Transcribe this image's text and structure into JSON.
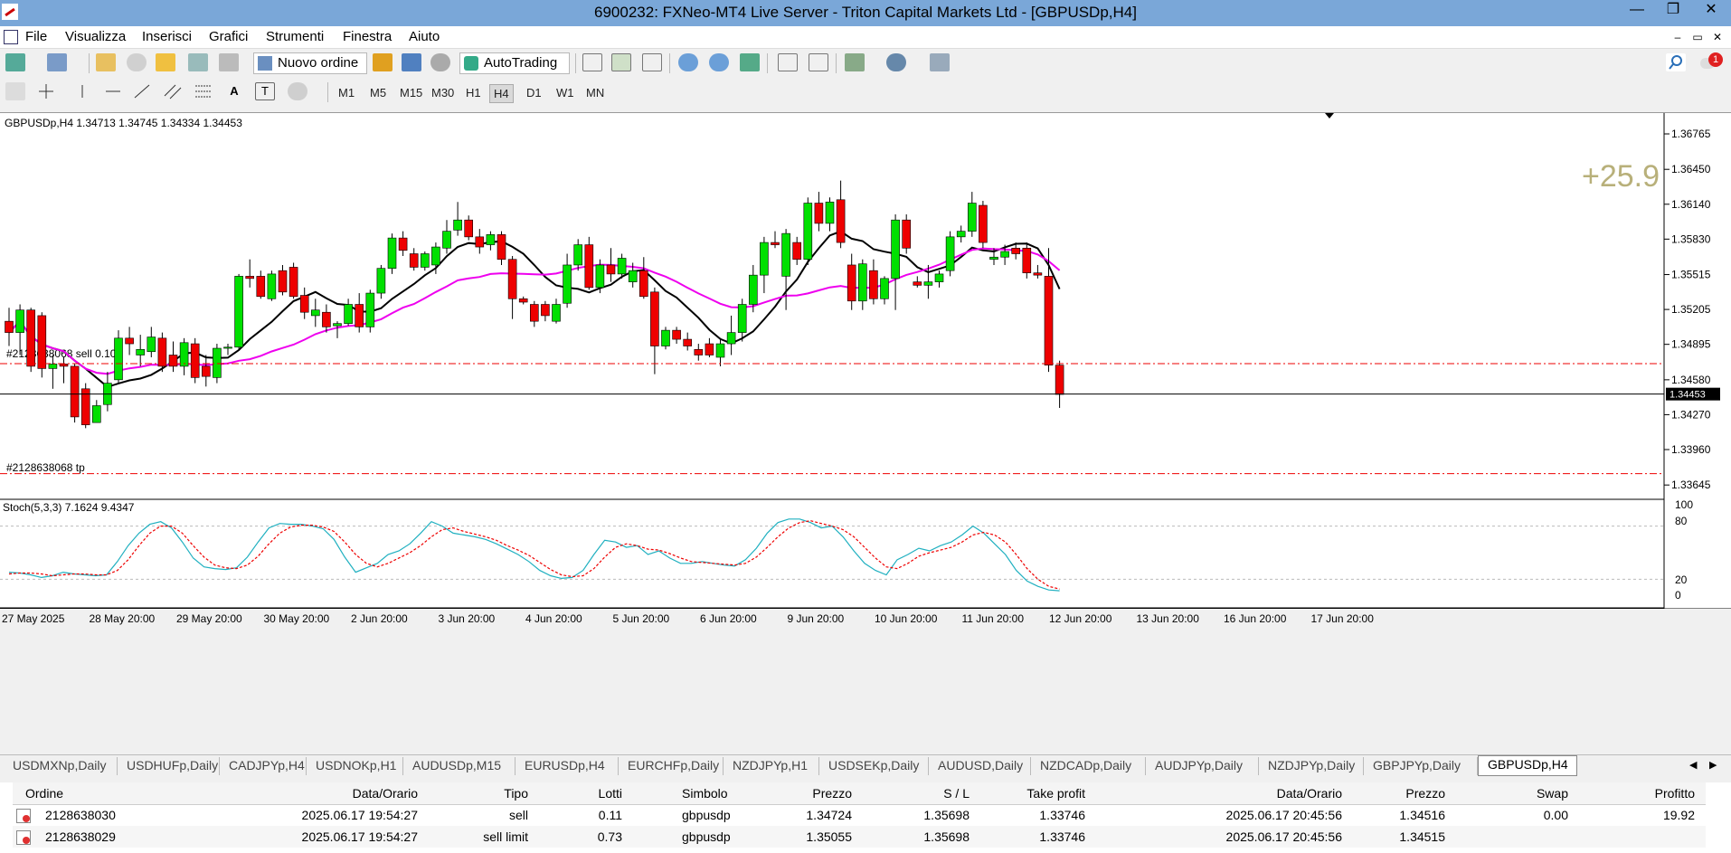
{
  "window": {
    "title": "6900232: FXNeo-MT4 Live Server - Triton Capital Markets Ltd - [GBPUSDp,H4]",
    "minimize": "—",
    "restore": "❐",
    "close": "✕"
  },
  "menu": [
    "File",
    "Visualizza",
    "Inserisci",
    "Grafici",
    "Strumenti",
    "Finestra",
    "Aiuto"
  ],
  "mdi": {
    "minimize": "–",
    "restore": "▭",
    "close": "✕"
  },
  "notification_count": "1",
  "toolbar": {
    "new_order": "Nuovo ordine",
    "autotrading": "AutoTrading"
  },
  "timeframes": [
    "M1",
    "M5",
    "M15",
    "M30",
    "H1",
    "H4",
    "D1",
    "W1",
    "MN"
  ],
  "active_timeframe": "H4",
  "chart": {
    "header": "GBPUSDp,H4  1.34713 1.34745 1.34334 1.34453",
    "profit_display": "+25.9",
    "order_label": "#2128638068 sell 0.10",
    "tp_label": "#2128638068 tp",
    "current_price": "1.34453",
    "price_labels": [
      "1.36765",
      "1.36450",
      "1.36140",
      "1.35830",
      "1.35515",
      "1.35205",
      "1.34895",
      "1.34580",
      "1.34270",
      "1.33960",
      "1.33645"
    ],
    "time_labels": [
      "27 May 2025",
      "28 May 20:00",
      "29 May 20:00",
      "30 May 20:00",
      "2 Jun 20:00",
      "3 Jun 20:00",
      "4 Jun 20:00",
      "5 Jun 20:00",
      "6 Jun 20:00",
      "9 Jun 20:00",
      "10 Jun 20:00",
      "11 Jun 20:00",
      "12 Jun 20:00",
      "13 Jun 20:00",
      "16 Jun 20:00",
      "17 Jun 20:00"
    ],
    "colors": {
      "bull": "#00e000",
      "bear": "#ee0000",
      "ma_fast": "#000000",
      "ma_slow": "#ee00ee",
      "stoch_main": "#20b0c0",
      "stoch_signal": "#ee0000"
    }
  },
  "stochastic": {
    "label": "Stoch(5,3,3) 7.1624 9.4347",
    "levels": [
      "100",
      "80",
      "20",
      "0"
    ]
  },
  "chart_data": {
    "type": "candlestick",
    "symbol": "GBPUSDp",
    "timeframe": "H4",
    "ylim": [
      1.3355,
      1.3695
    ],
    "candles": [
      [
        1.351,
        1.3522,
        1.3488,
        1.35
      ],
      [
        1.35,
        1.3525,
        1.348,
        1.352
      ],
      [
        1.352,
        1.3522,
        1.3465,
        1.347
      ],
      [
        1.3515,
        1.3518,
        1.346,
        1.3468
      ],
      [
        1.3468,
        1.348,
        1.345,
        1.3472
      ],
      [
        1.3472,
        1.3478,
        1.3455,
        1.347
      ],
      [
        1.347,
        1.3472,
        1.342,
        1.3425
      ],
      [
        1.345,
        1.3455,
        1.3415,
        1.3418
      ],
      [
        1.342,
        1.344,
        1.342,
        1.3435
      ],
      [
        1.3436,
        1.3465,
        1.343,
        1.3455
      ],
      [
        1.3458,
        1.3502,
        1.3455,
        1.3495
      ],
      [
        1.3495,
        1.3505,
        1.348,
        1.349
      ],
      [
        1.348,
        1.3498,
        1.347,
        1.3485
      ],
      [
        1.3483,
        1.3505,
        1.3478,
        1.3496
      ],
      [
        1.3495,
        1.35,
        1.3465,
        1.347
      ],
      [
        1.348,
        1.3492,
        1.3465,
        1.347
      ],
      [
        1.347,
        1.3495,
        1.3462,
        1.3491
      ],
      [
        1.349,
        1.3495,
        1.3455,
        1.346
      ],
      [
        1.347,
        1.348,
        1.3452,
        1.3461
      ],
      [
        1.346,
        1.349,
        1.3455,
        1.3486
      ],
      [
        1.3486,
        1.349,
        1.348,
        1.3487
      ],
      [
        1.3487,
        1.3552,
        1.3485,
        1.355
      ],
      [
        1.355,
        1.3565,
        1.354,
        1.3548
      ],
      [
        1.355,
        1.3555,
        1.353,
        1.3532
      ],
      [
        1.353,
        1.3555,
        1.3528,
        1.3552
      ],
      [
        1.3555,
        1.356,
        1.3533,
        1.3536
      ],
      [
        1.3558,
        1.3562,
        1.353,
        1.3532
      ],
      [
        1.3533,
        1.354,
        1.3512,
        1.3518
      ],
      [
        1.3515,
        1.353,
        1.3505,
        1.352
      ],
      [
        1.3518,
        1.3525,
        1.35,
        1.3505
      ],
      [
        1.3506,
        1.351,
        1.3495,
        1.3508
      ],
      [
        1.3508,
        1.353,
        1.3506,
        1.3525
      ],
      [
        1.3525,
        1.3535,
        1.35,
        1.3505
      ],
      [
        1.3505,
        1.3538,
        1.35,
        1.3535
      ],
      [
        1.3535,
        1.356,
        1.353,
        1.3557
      ],
      [
        1.3557,
        1.3588,
        1.3552,
        1.3584
      ],
      [
        1.3584,
        1.359,
        1.3568,
        1.3573
      ],
      [
        1.357,
        1.3575,
        1.3555,
        1.3558
      ],
      [
        1.3558,
        1.3572,
        1.3555,
        1.357
      ],
      [
        1.356,
        1.358,
        1.3552,
        1.3576
      ],
      [
        1.3575,
        1.36,
        1.357,
        1.359
      ],
      [
        1.3591,
        1.3616,
        1.3586,
        1.36
      ],
      [
        1.36,
        1.3604,
        1.3582,
        1.3585
      ],
      [
        1.3585,
        1.3592,
        1.357,
        1.3576
      ],
      [
        1.3578,
        1.359,
        1.3573,
        1.3587
      ],
      [
        1.3587,
        1.359,
        1.356,
        1.3565
      ],
      [
        1.3565,
        1.3568,
        1.3512,
        1.353
      ],
      [
        1.353,
        1.3532,
        1.3525,
        1.3527
      ],
      [
        1.3525,
        1.3528,
        1.3505,
        1.351
      ],
      [
        1.3525,
        1.3528,
        1.351,
        1.3515
      ],
      [
        1.351,
        1.353,
        1.3508,
        1.3525
      ],
      [
        1.3526,
        1.357,
        1.3522,
        1.356
      ],
      [
        1.356,
        1.3583,
        1.3555,
        1.3578
      ],
      [
        1.3578,
        1.3585,
        1.3538,
        1.354
      ],
      [
        1.354,
        1.3565,
        1.3535,
        1.356
      ],
      [
        1.356,
        1.3575,
        1.3545,
        1.3552
      ],
      [
        1.3552,
        1.357,
        1.3548,
        1.3566
      ],
      [
        1.3545,
        1.3562,
        1.354,
        1.3555
      ],
      [
        1.3555,
        1.3567,
        1.353,
        1.3532
      ],
      [
        1.3536,
        1.354,
        1.3463,
        1.3488
      ],
      [
        1.3488,
        1.3505,
        1.3485,
        1.3502
      ],
      [
        1.3502,
        1.3505,
        1.349,
        1.3494
      ],
      [
        1.3494,
        1.35,
        1.3484,
        1.3488
      ],
      [
        1.3485,
        1.349,
        1.3475,
        1.348
      ],
      [
        1.349,
        1.3495,
        1.3478,
        1.348
      ],
      [
        1.3478,
        1.3495,
        1.347,
        1.349
      ],
      [
        1.349,
        1.3515,
        1.348,
        1.35
      ],
      [
        1.35,
        1.353,
        1.3492,
        1.3525
      ],
      [
        1.3525,
        1.356,
        1.3518,
        1.3551
      ],
      [
        1.3551,
        1.3585,
        1.3535,
        1.358
      ],
      [
        1.358,
        1.359,
        1.3575,
        1.3578
      ],
      [
        1.355,
        1.3592,
        1.352,
        1.3588
      ],
      [
        1.358,
        1.3585,
        1.356,
        1.3565
      ],
      [
        1.3565,
        1.362,
        1.356,
        1.3615
      ],
      [
        1.3615,
        1.3625,
        1.359,
        1.3597
      ],
      [
        1.3597,
        1.362,
        1.359,
        1.3616
      ],
      [
        1.3618,
        1.3635,
        1.3575,
        1.358
      ],
      [
        1.356,
        1.357,
        1.352,
        1.3528
      ],
      [
        1.3528,
        1.3565,
        1.352,
        1.3561
      ],
      [
        1.3555,
        1.3565,
        1.3525,
        1.353
      ],
      [
        1.353,
        1.355,
        1.3525,
        1.3548
      ],
      [
        1.3548,
        1.3605,
        1.352,
        1.36
      ],
      [
        1.36,
        1.3605,
        1.357,
        1.3575
      ],
      [
        1.3545,
        1.355,
        1.354,
        1.3542
      ],
      [
        1.3542,
        1.356,
        1.353,
        1.3545
      ],
      [
        1.3545,
        1.3555,
        1.354,
        1.3552
      ],
      [
        1.3555,
        1.359,
        1.355,
        1.3585
      ],
      [
        1.3585,
        1.3595,
        1.358,
        1.359
      ],
      [
        1.359,
        1.3625,
        1.3585,
        1.3615
      ],
      [
        1.3613,
        1.3617,
        1.3575,
        1.358
      ],
      [
        1.3565,
        1.3575,
        1.356,
        1.3567
      ],
      [
        1.3567,
        1.3578,
        1.356,
        1.3572
      ],
      [
        1.3575,
        1.358,
        1.3565,
        1.357
      ],
      [
        1.3575,
        1.358,
        1.3548,
        1.3553
      ],
      [
        1.3553,
        1.356,
        1.3548,
        1.3551
      ],
      [
        1.355,
        1.3575,
        1.3465,
        1.3471
      ],
      [
        1.3471,
        1.3475,
        1.3433,
        1.3445
      ]
    ],
    "indicators": [
      "MA fast (black)",
      "MA slow (magenta)"
    ],
    "order_price": 1.34724,
    "take_profit": 1.33746,
    "bid": 1.34453,
    "stochastic": {
      "ylim": [
        0,
        100
      ],
      "main": [
        28,
        27,
        25,
        22,
        24,
        28,
        26,
        25,
        24,
        25,
        40,
        58,
        72,
        82,
        85,
        78,
        62,
        44,
        34,
        32,
        31,
        33,
        45,
        62,
        78,
        83,
        82,
        82,
        80,
        77,
        65,
        45,
        28,
        33,
        38,
        48,
        52,
        60,
        72,
        85,
        80,
        72,
        70,
        68,
        65,
        60,
        54,
        48,
        40,
        30,
        24,
        21,
        22,
        30,
        48,
        64,
        62,
        56,
        58,
        48,
        52,
        44,
        38,
        38,
        40,
        38,
        36,
        35,
        42,
        55,
        72,
        84,
        88,
        88,
        84,
        78,
        80,
        68,
        52,
        38,
        30,
        25,
        42,
        48,
        55,
        52,
        58,
        62,
        70,
        80,
        72,
        60,
        48,
        30,
        18,
        12,
        8,
        7
      ],
      "signal": [
        26,
        27,
        27,
        26,
        24,
        25,
        26,
        26,
        25,
        25,
        30,
        42,
        58,
        72,
        80,
        80,
        72,
        58,
        45,
        36,
        33,
        32,
        36,
        46,
        60,
        72,
        79,
        81,
        81,
        79,
        74,
        62,
        48,
        38,
        34,
        38,
        44,
        50,
        58,
        68,
        76,
        78,
        74,
        71,
        68,
        64,
        58,
        53,
        47,
        39,
        31,
        25,
        23,
        24,
        32,
        45,
        56,
        60,
        58,
        54,
        53,
        49,
        44,
        40,
        39,
        38,
        37,
        36,
        38,
        45,
        56,
        68,
        78,
        84,
        86,
        83,
        80,
        76,
        68,
        56,
        44,
        34,
        32,
        38,
        46,
        50,
        53,
        56,
        62,
        70,
        73,
        70,
        62,
        48,
        32,
        20,
        12,
        9
      ]
    }
  },
  "symbol_tabs": [
    "USDMXNp,Daily",
    "USDHUFp,Daily",
    "CADJPYp,H4",
    "USDNOKp,H1",
    "AUDUSDp,M15",
    "EURUSDp,H4",
    "EURCHFp,Daily",
    "NZDJPYp,H1",
    "USDSEKp,Daily",
    "AUDUSD,Daily",
    "NZDCADp,Daily",
    "AUDJPYp,Daily",
    "NZDJPYp,Daily",
    "GBPJPYp,Daily",
    "GBPUSDp,H4"
  ],
  "active_tab": "GBPUSDp,H4",
  "terminal": {
    "columns": [
      "Ordine",
      "Data/Orario",
      "Tipo",
      "Lotti",
      "Simbolo",
      "Prezzo",
      "S / L",
      "Take profit",
      "Data/Orario",
      "Prezzo",
      "Swap",
      "Profitto"
    ],
    "rows": [
      [
        "2128638030",
        "2025.06.17 19:54:27",
        "sell",
        "0.11",
        "gbpusdp",
        "1.34724",
        "1.35698",
        "1.33746",
        "2025.06.17 20:45:56",
        "1.34516",
        "0.00",
        "19.92"
      ],
      [
        "2128638029",
        "2025.06.17 19:54:27",
        "sell limit",
        "0.73",
        "gbpusdp",
        "1.35055",
        "1.35698",
        "1.33746",
        "2025.06.17 20:45:56",
        "1.34515",
        "",
        ""
      ]
    ]
  }
}
